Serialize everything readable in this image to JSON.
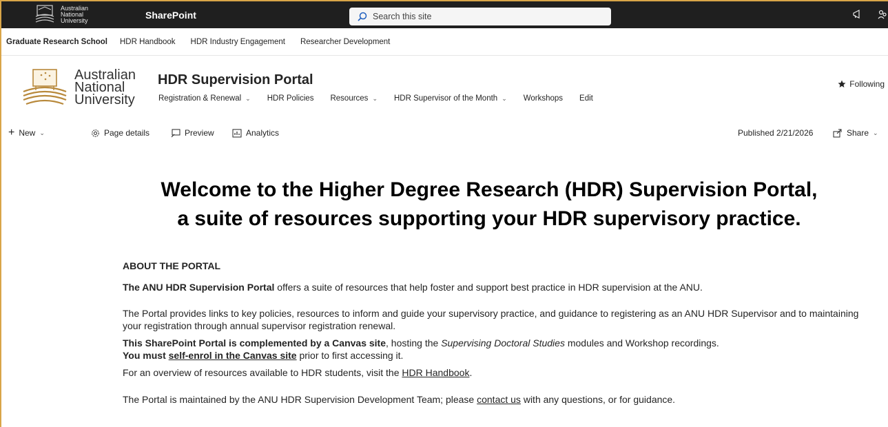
{
  "suite_bar": {
    "logo_lines": [
      "Australian",
      "National",
      "University"
    ],
    "app_name": "SharePoint",
    "search_placeholder": "Search this site",
    "icons": [
      "megaphone-icon",
      "share-people-icon"
    ]
  },
  "hub_nav": {
    "title": "Graduate Research School",
    "links": [
      "HDR Handbook",
      "HDR Industry Engagement",
      "Researcher Development"
    ]
  },
  "site_header": {
    "logo_lines": [
      "Australian",
      "National",
      "University"
    ],
    "title": "HDR Supervision Portal",
    "nav": [
      "Registration & Renewal",
      "HDR Policies",
      "Resources",
      "HDR Supervisor of the Month",
      "Workshops",
      "Edit"
    ],
    "following_label": "Following"
  },
  "command_bar": {
    "new_label": "New",
    "page_details_label": "Page details",
    "preview_label": "Preview",
    "analytics_label": "Analytics",
    "published_label": "Published 2/21/2026",
    "share_label": "Share"
  },
  "content": {
    "headline_line1": "Welcome to the Higher Degree Research (HDR) Supervision Portal,",
    "headline_line2": "a suite of resources supporting your HDR supervisory practice.",
    "about_heading": "ABOUT THE PORTAL",
    "p1_bold": "The ANU HDR Supervision Portal",
    "p1_rest": " offers a suite of resources that help foster and support best practice in HDR supervision at the ANU.",
    "p2": "The Portal provides links to key policies, resources to inform and guide your supervisory practice, and guidance to registering as an ANU HDR Supervisor and to maintaining your registration through annual supervisor registration renewal.",
    "p3_bold": "This SharePoint Portal is complemented by a Canvas site",
    "p3_mid": ", hosting the ",
    "p3_italic": "Supervising Doctoral Studies",
    "p3_end": " modules and Workshop recordings.",
    "p4_bold": "You must ",
    "p4_link": "self-enrol in the Canvas site",
    "p4_rest": " prior to first accessing it.",
    "p5_pre": "For an overview of resources available to HDR students, visit the ",
    "p5_link": "HDR Handbook",
    "p5_post": ".",
    "p6_pre": "The Portal is maintained by the ANU HDR Supervision Development Team; please ",
    "p6_link": "contact us",
    "p6_post": " with any questions, or for guidance."
  },
  "colors": {
    "suite_bar_bg": "#1f1f1f",
    "frame_accent": "#d9a548",
    "logo_gold": "#b8893c"
  }
}
